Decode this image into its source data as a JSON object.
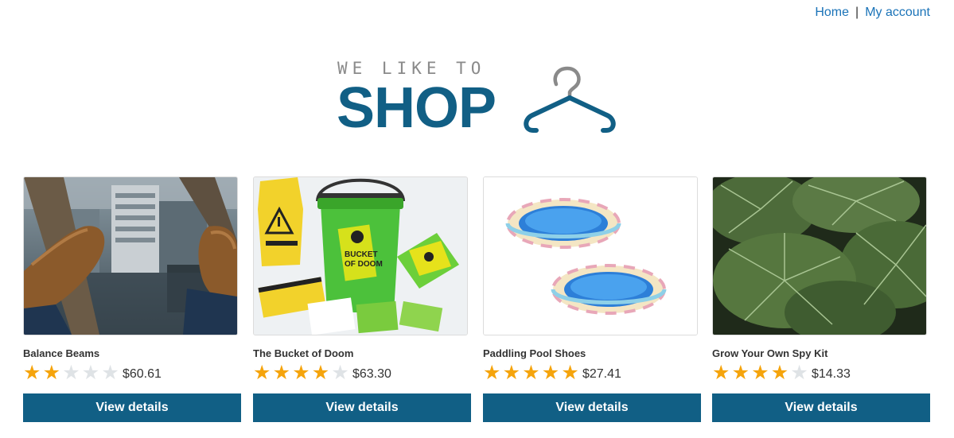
{
  "nav": {
    "home_label": "Home",
    "separator": "|",
    "account_label": "My account"
  },
  "logo": {
    "tagline": "WE LIKE TO",
    "word": "SHOP",
    "icon": "hanger-icon",
    "color": "#115f85"
  },
  "colors": {
    "accent": "#115f85",
    "link": "#1a73b8",
    "star_on": "#f5a40c",
    "star_off": "#dfe3e6"
  },
  "products": [
    {
      "name": "Balance Beams",
      "rating": 2,
      "max_rating": 5,
      "price": "$60.61",
      "button": "View details",
      "image": "balance-beams-image"
    },
    {
      "name": "The Bucket of Doom",
      "rating": 4,
      "max_rating": 5,
      "price": "$63.30",
      "button": "View details",
      "image": "bucket-of-doom-image"
    },
    {
      "name": "Paddling Pool Shoes",
      "rating": 5,
      "max_rating": 5,
      "price": "$27.41",
      "button": "View details",
      "image": "paddling-pool-shoes-image"
    },
    {
      "name": "Grow Your Own Spy Kit",
      "rating": 4,
      "max_rating": 5,
      "price": "$14.33",
      "button": "View details",
      "image": "spy-kit-image"
    }
  ]
}
